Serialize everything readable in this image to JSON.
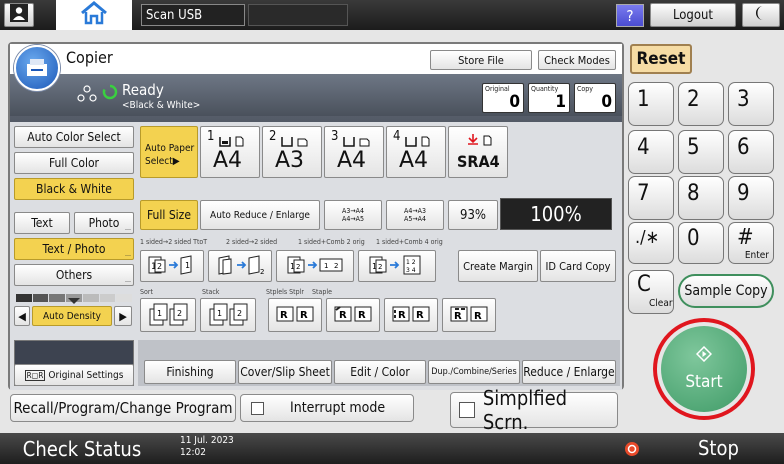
{
  "topbar": {
    "user_icon": "user-icon",
    "home_icon": "home-icon",
    "scan_usb_label": "Scan USB",
    "help_label": "?",
    "logout_label": "Logout",
    "moon_icon": "moon-icon"
  },
  "copier": {
    "title": "Copier",
    "store_file_label": "Store File",
    "check_modes_label": "Check Modes",
    "status_text": "Ready",
    "status_sub": "<Black & White>",
    "counters": {
      "original_label": "Original",
      "original_value": "0",
      "quantity_label": "Quantity",
      "quantity_value": "1",
      "copy_label": "Copy",
      "copy_value": "0"
    },
    "left": {
      "auto_color_select": "Auto Color Select",
      "full_color": "Full Color",
      "black_white": "Black & White",
      "text": "Text",
      "photo": "Photo",
      "text_photo": "Text / Photo",
      "others": "Others",
      "auto_density": "Auto Density",
      "original_settings": "Original Settings"
    },
    "paper": {
      "auto_paper_select": "Auto Paper",
      "auto_paper_select2": "Select▶",
      "trays": [
        {
          "num": "1",
          "size": "A4"
        },
        {
          "num": "2",
          "size": "A3"
        },
        {
          "num": "3",
          "size": "A4"
        },
        {
          "num": "4",
          "size": "A4"
        }
      ],
      "bypass_size": "SRA4"
    },
    "reduce": {
      "full_size": "Full Size",
      "auto_reduce_enlarge": "Auto Reduce / Enlarge",
      "preset1_a": "A3→A4",
      "preset1_b": "A4→A5",
      "preset2_a": "A4→A3",
      "preset2_b": "A5→A4",
      "ratio_small": "93%",
      "ratio_big": "100%"
    },
    "duplex": {
      "label1": "1 sided→2 sided TtoT",
      "label2": "2 sided→2 sided",
      "label3": "1 sided+Comb 2 orig",
      "label4": "1 sided+Comb 4 orig",
      "create_margin": "Create Margin",
      "id_card_copy": "ID Card Copy"
    },
    "finish": {
      "sort": "Sort",
      "stack": "Stack",
      "stapleless": "Stplels Stplr",
      "staple": "Staple"
    },
    "tabs": {
      "finishing": "Finishing",
      "cover_slip": "Cover/Slip Sheet",
      "edit_color": "Edit / Color",
      "dup_combine": "Dup./Combine/Series",
      "reduce_enlarge": "Reduce / Enlarge"
    },
    "recall_program": "Recall/Program/Change Program",
    "interrupt_mode": "Interrupt mode",
    "simplified_screen": "Simplfied Scrn."
  },
  "keypad": {
    "reset": "Reset",
    "keys": [
      "1",
      "2",
      "3",
      "4",
      "5",
      "6",
      "7",
      "8",
      "9"
    ],
    "star": "./∗",
    "zero": "0",
    "hash": "#",
    "enter": "Enter",
    "clear_c": "C",
    "clear": "Clear",
    "sample_copy": "Sample Copy",
    "start": "Start"
  },
  "bottombar": {
    "check_status": "Check Status",
    "date": "11 Jul. 2023",
    "time": "12:02",
    "stop": "Stop"
  },
  "colors": {
    "selected_yellow": "#f3d250",
    "start_green": "#4fa873",
    "highlight_red": "#e0161e"
  }
}
